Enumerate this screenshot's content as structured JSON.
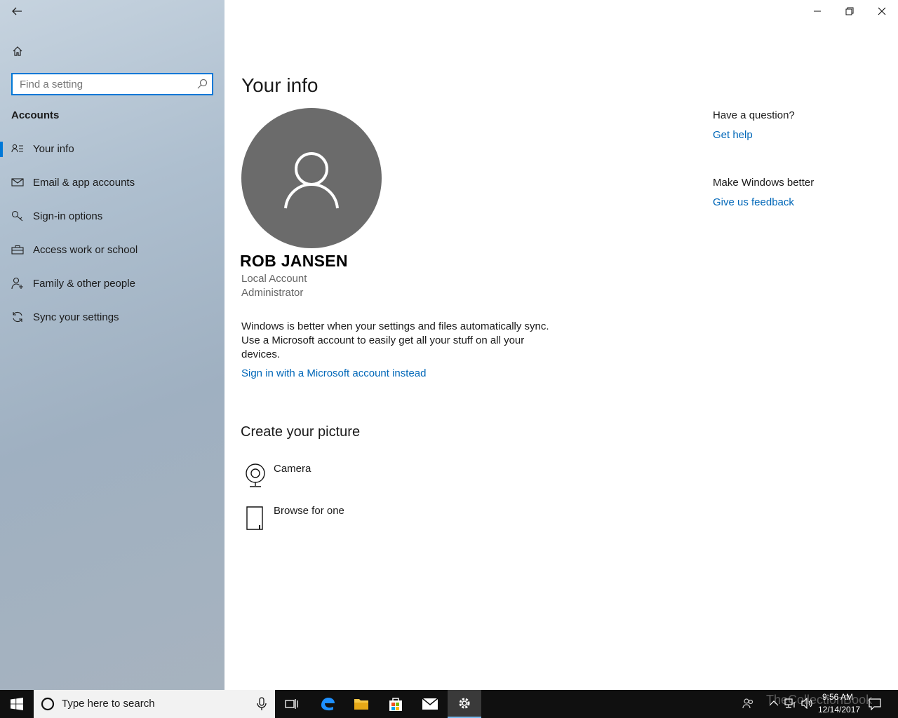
{
  "sidebar": {
    "search_placeholder": "Find a setting",
    "section_title": "Accounts",
    "items": [
      {
        "label": "Your info",
        "icon": "person-card-icon",
        "active": true
      },
      {
        "label": "Email & app accounts",
        "icon": "mail-icon",
        "active": false
      },
      {
        "label": "Sign-in options",
        "icon": "key-icon",
        "active": false
      },
      {
        "label": "Access work or school",
        "icon": "briefcase-icon",
        "active": false
      },
      {
        "label": "Family & other people",
        "icon": "person-add-icon",
        "active": false
      },
      {
        "label": "Sync your settings",
        "icon": "sync-icon",
        "active": false
      }
    ]
  },
  "main": {
    "title": "Your info",
    "user_name": "ROB JANSEN",
    "account_type": "Local Account",
    "role": "Administrator",
    "sync_message": "Windows is better when your settings and files automatically sync. Use a Microsoft account to easily get all your stuff on all your devices.",
    "ms_link": "Sign in with a Microsoft account instead",
    "create_picture_title": "Create your picture",
    "picture_options": [
      {
        "label": "Camera",
        "icon": "camera-icon"
      },
      {
        "label": "Browse for one",
        "icon": "file-icon"
      }
    ]
  },
  "help": {
    "question_heading": "Have a question?",
    "get_help": "Get help",
    "feedback_heading": "Make Windows better",
    "feedback_link": "Give us feedback"
  },
  "taskbar": {
    "search_text": "Type here to search",
    "time": "9:56 AM",
    "date": "12/14/2017",
    "watermark": "TheCollectionBook"
  },
  "colors": {
    "accent": "#0078d7",
    "link": "#0067b8",
    "avatar_bg": "#6b6b6b",
    "taskbar_bg": "#101010"
  }
}
